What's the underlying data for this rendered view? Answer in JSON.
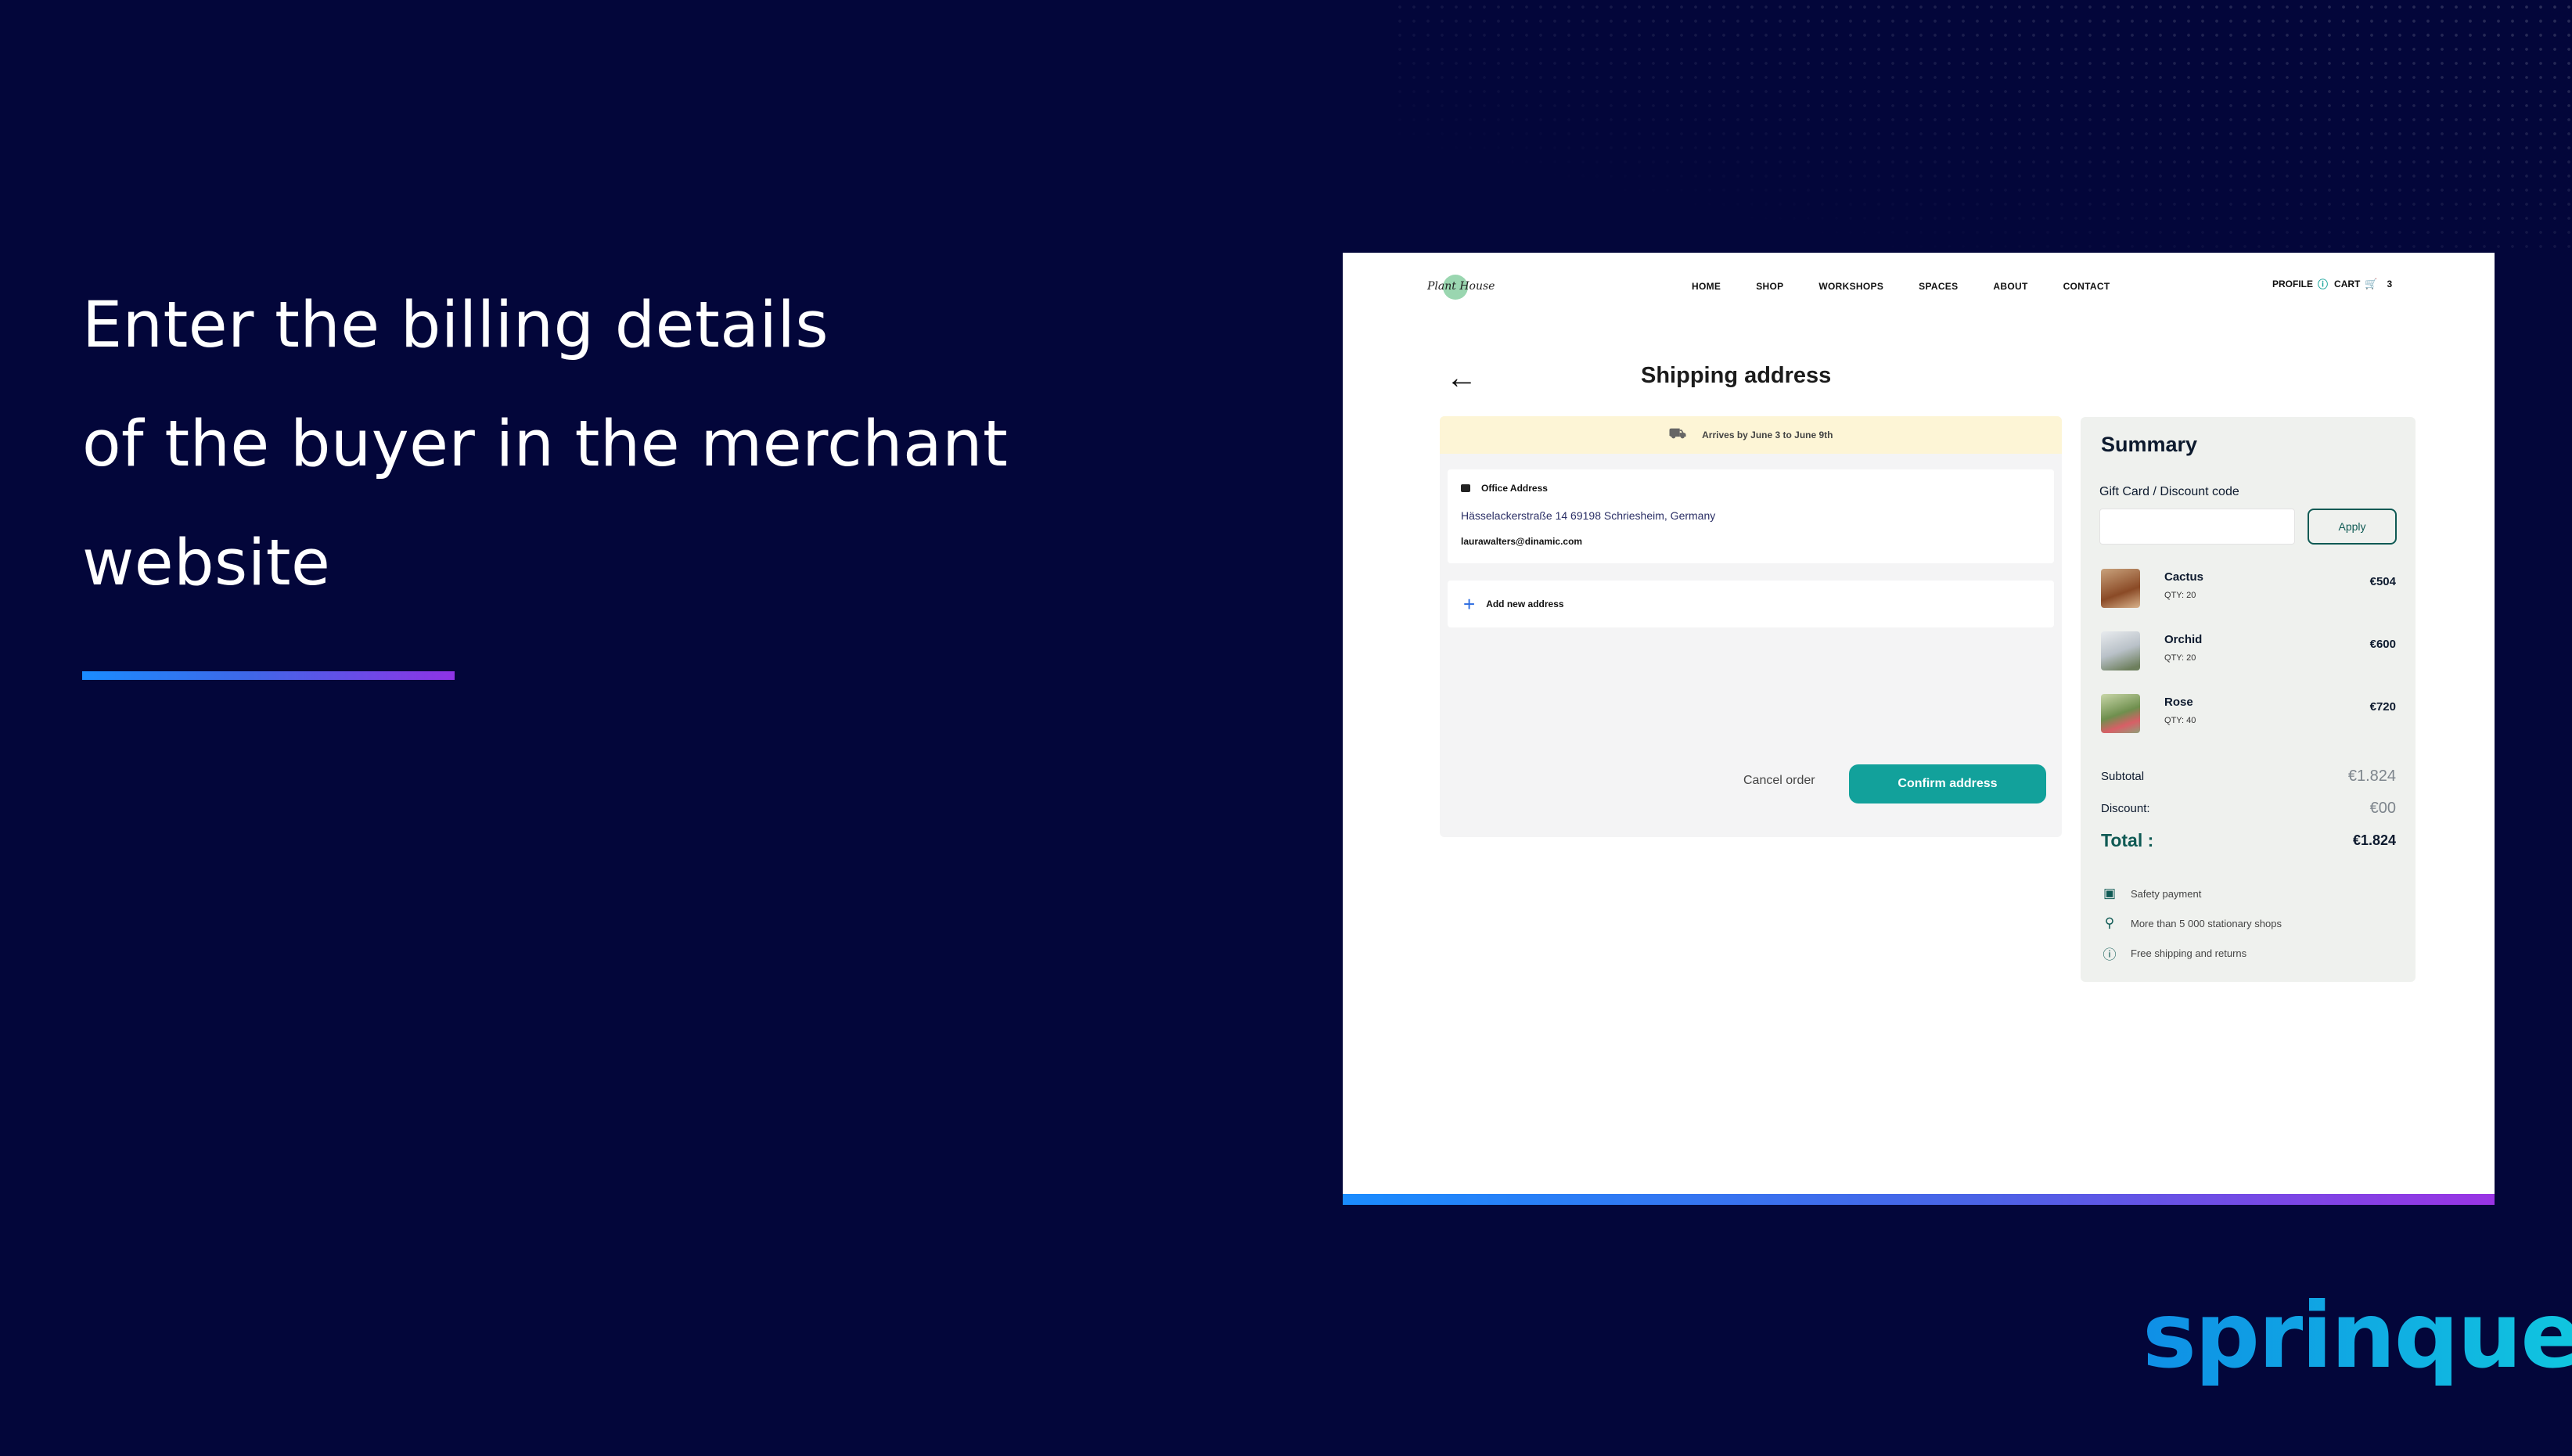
{
  "slide": {
    "headline_lines": [
      "Enter the billing details",
      "of the buyer in the merchant",
      "website"
    ],
    "brand": "sprinque",
    "colors": {
      "background": "#03063a",
      "accent": "#12a19b",
      "brand": "#10b4e3"
    }
  },
  "site": {
    "logo_text": "Plant House",
    "nav": [
      "HOME",
      "SHOP",
      "WORKSHOPS",
      "SPACES",
      "ABOUT",
      "CONTACT"
    ],
    "profile_label": "PROFILE",
    "cart_label": "CART",
    "cart_count": "3",
    "icons": {
      "profile": "user-circle-icon",
      "cart": "cart-icon",
      "back": "arrow-left-icon"
    }
  },
  "checkout": {
    "title": "Shipping address",
    "arrival": "Arrives by June 3 to June 9th",
    "address": {
      "type": "Office Address",
      "line": "Hässelackerstraße 14  69198 Schriesheim, Germany",
      "email": "laurawalters@dinamic.com"
    },
    "add_address_label": "Add new address",
    "cancel_label": "Cancel order",
    "confirm_label": "Confirm address"
  },
  "summary": {
    "title": "Summary",
    "gift_label": "Gift Card / Discount code",
    "gift_placeholder": "",
    "apply_label": "Apply",
    "items": [
      {
        "name": "Cactus",
        "qty": "QTY: 20",
        "price": "€504"
      },
      {
        "name": "Orchid",
        "qty": "QTY: 20",
        "price": "€600"
      },
      {
        "name": "Rose",
        "qty": "QTY: 40",
        "price": "€720"
      }
    ],
    "subtotal_label": "Subtotal",
    "subtotal_value": "€1.824",
    "discount_label": "Discount:",
    "discount_value": "€00",
    "total_label": "Total :",
    "total_value": "€1.824",
    "perks": [
      {
        "icon": "credit-card-icon",
        "label": "Safety payment"
      },
      {
        "icon": "map-pin-icon",
        "label": "More than 5 000 stationary shops"
      },
      {
        "icon": "info-icon",
        "label": "Free shipping and returns"
      }
    ]
  }
}
